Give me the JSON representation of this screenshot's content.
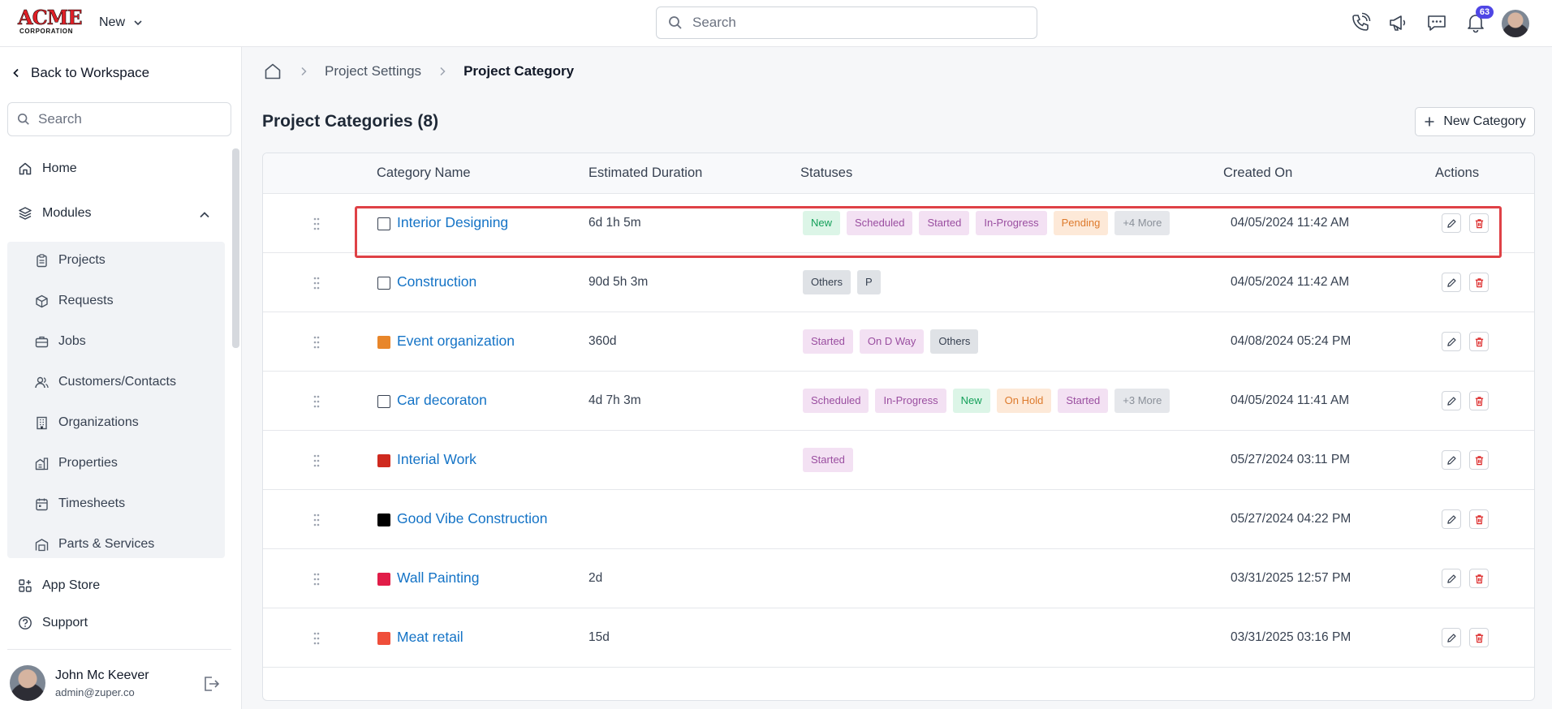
{
  "topbar": {
    "logo_line1": "ACME",
    "logo_line2": "CORPORATION",
    "new_label": "New",
    "search_placeholder": "Search",
    "notification_count": "63",
    "icons": [
      "phone-icon",
      "megaphone-icon",
      "chat-icon",
      "bell-icon",
      "avatar"
    ]
  },
  "sidebar": {
    "back_label": "Back to Workspace",
    "search_placeholder": "Search",
    "home_label": "Home",
    "modules_label": "Modules",
    "modules": [
      {
        "label": "Projects",
        "icon": "clipboard-icon"
      },
      {
        "label": "Requests",
        "icon": "package-icon"
      },
      {
        "label": "Jobs",
        "icon": "briefcase-icon"
      },
      {
        "label": "Customers/Contacts",
        "icon": "users-icon"
      },
      {
        "label": "Organizations",
        "icon": "building-icon"
      },
      {
        "label": "Properties",
        "icon": "property-icon"
      },
      {
        "label": "Timesheets",
        "icon": "calendar-icon"
      },
      {
        "label": "Parts & Services",
        "icon": "warehouse-icon"
      }
    ],
    "app_store_label": "App Store",
    "support_label": "Support",
    "user": {
      "name": "John Mc Keever",
      "email": "admin@zuper.co"
    }
  },
  "breadcrumb": {
    "items": [
      "Project Settings",
      "Project Category"
    ]
  },
  "page": {
    "title": "Project Categories (8)",
    "new_category_label": "New Category"
  },
  "table": {
    "columns": [
      "Category Name",
      "Estimated Duration",
      "Statuses",
      "Created On",
      "Actions"
    ],
    "rows": [
      {
        "name": "Interior Designing",
        "swatch": "#ffffff",
        "outlined": true,
        "duration": "6d 1h 5m",
        "statuses": [
          "New",
          "Scheduled",
          "Started",
          "In-Progress",
          "Pending",
          "+4 More"
        ],
        "created": "04/05/2024 11:42 AM"
      },
      {
        "name": "Construction",
        "swatch": "#ffffff",
        "outlined": true,
        "duration": "90d 5h 3m",
        "statuses": [
          "Others",
          "P"
        ],
        "created": "04/05/2024 11:42 AM"
      },
      {
        "name": "Event organization",
        "swatch": "#e8862a",
        "outlined": false,
        "duration": "360d",
        "statuses": [
          "Started",
          "On D Way",
          "Others"
        ],
        "created": "04/08/2024 05:24 PM"
      },
      {
        "name": "Car decoraton",
        "swatch": "#ffffff",
        "outlined": true,
        "duration": "4d 7h 3m",
        "statuses": [
          "Scheduled",
          "In-Progress",
          "New",
          "On Hold",
          "Started",
          "+3 More"
        ],
        "created": "04/05/2024 11:41 AM"
      },
      {
        "name": "Interial Work",
        "swatch": "#cf2a1f",
        "outlined": false,
        "duration": "",
        "statuses": [
          "Started"
        ],
        "created": "05/27/2024 03:11 PM"
      },
      {
        "name": "Good Vibe Construction",
        "swatch": "#000000",
        "outlined": false,
        "duration": "",
        "statuses": [],
        "created": "05/27/2024 04:22 PM"
      },
      {
        "name": "Wall Painting",
        "swatch": "#e11d48",
        "outlined": false,
        "duration": "2d",
        "statuses": [],
        "created": "03/31/2025 12:57 PM"
      },
      {
        "name": "Meat retail",
        "swatch": "#ef4e3a",
        "outlined": false,
        "duration": "15d",
        "statuses": [],
        "created": "03/31/2025 03:16 PM"
      }
    ],
    "status_styles": {
      "New": {
        "bg": "#dcf5e7",
        "fg": "#15a05a"
      },
      "Scheduled": {
        "bg": "#f3e1f3",
        "fg": "#9a4ea0"
      },
      "Started": {
        "bg": "#f3e1f3",
        "fg": "#9a4ea0"
      },
      "In-Progress": {
        "bg": "#f3e1f3",
        "fg": "#9a4ea0"
      },
      "Pending": {
        "bg": "#fde9d8",
        "fg": "#dd7a2c"
      },
      "On Hold": {
        "bg": "#fde9d8",
        "fg": "#dd7a2c"
      },
      "On D Way": {
        "bg": "#f3e1f3",
        "fg": "#9a4ea0"
      },
      "Others": {
        "bg": "#dfe2e6",
        "fg": "#374151"
      },
      "P": {
        "bg": "#dfe2e6",
        "fg": "#374151"
      },
      "more": {
        "bg": "#e5e7eb",
        "fg": "#8a9099"
      }
    }
  },
  "colors": {
    "link": "#1473c6",
    "highlight": "#df4146",
    "badge": "#4f46e5",
    "delete": "#dc2626"
  }
}
